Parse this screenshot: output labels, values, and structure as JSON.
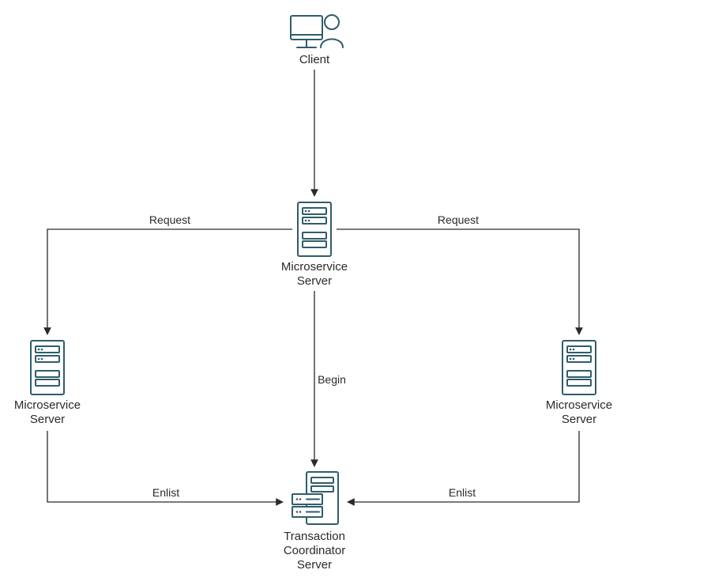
{
  "colors": {
    "icon_stroke": "#2f5d6b",
    "arrow": "#2a2a2a",
    "label": "#2a2a2a",
    "background": "#ffffff"
  },
  "nodes": {
    "client": {
      "label_line1": "Client"
    },
    "ms_top": {
      "label_line1": "Microservice",
      "label_line2": "Server"
    },
    "ms_left": {
      "label_line1": "Microservice",
      "label_line2": "Server"
    },
    "ms_right": {
      "label_line1": "Microservice",
      "label_line2": "Server"
    },
    "coordinator": {
      "label_line1": "Transaction",
      "label_line2": "Coordinator",
      "label_line3": "Server"
    }
  },
  "edges": {
    "client_to_ms_top": {
      "label": ""
    },
    "ms_top_to_ms_left": {
      "label": "Request"
    },
    "ms_top_to_ms_right": {
      "label": "Request"
    },
    "ms_top_to_coordinator": {
      "label": "Begin"
    },
    "ms_left_to_coordinator": {
      "label": "Enlist"
    },
    "ms_right_to_coordinator": {
      "label": "Enlist"
    }
  }
}
